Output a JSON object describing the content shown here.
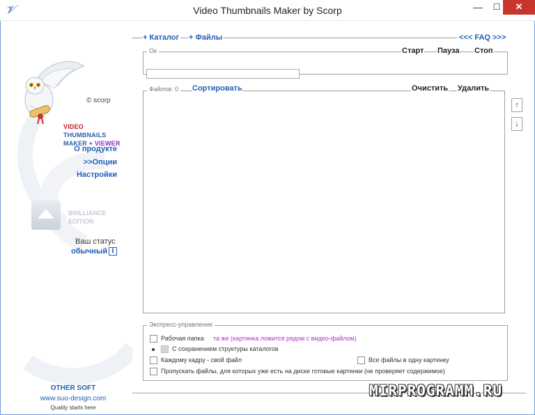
{
  "window": {
    "title": "Video Thumbnails Maker by Scorp",
    "min_glyph": "—",
    "max_glyph": "☐",
    "close_glyph": "✕"
  },
  "sidebar": {
    "scorp": "© scorp",
    "logo_line1": "VIDEO",
    "logo_line2": "THUMBNAILS",
    "logo_line3_a": "MAKER + ",
    "logo_line3_b": "VIEWER",
    "about": "О продукте",
    "options": ">>Опции",
    "settings": "Настройки",
    "brilliance_line1": "BRILLIANCE",
    "brilliance_line2": "EDITION",
    "status_label": "Ваш статус",
    "status_value": "обычный",
    "info": "i",
    "other_soft": "OTHER SOFT",
    "site": "www.suu-design.com",
    "tagline": "Quality starts here"
  },
  "toolbar": {
    "catalog": "+ Каталог",
    "files": "+ Файлы",
    "faq": "<<< FAQ >>>"
  },
  "progress_group": {
    "legend": "Ок",
    "start": "Старт",
    "pause": "Пауза",
    "stop": "Стоп"
  },
  "files_group": {
    "label": "Файлов: 0",
    "sort": "Сортировать",
    "clear": "Очистить",
    "delete": "Удалить",
    "up": "↑",
    "down": "↓"
  },
  "express": {
    "legend": "Экспресс-управление",
    "work_folder_label": "Рабочая папка",
    "work_folder_value": "та же (картинка ложится рядом с видео-файлом)",
    "keep_structure": "С сохранением структуры каталогов",
    "each_frame": "Каждому кадру - свой файл",
    "all_in_one": "Все файлы в одну картинку",
    "skip_existing": "Пропускать файлы, для которых уже есть на диске готовые картинки (не проверяет содержимое)"
  },
  "watermark": "MIRPROGRAMM.RU"
}
